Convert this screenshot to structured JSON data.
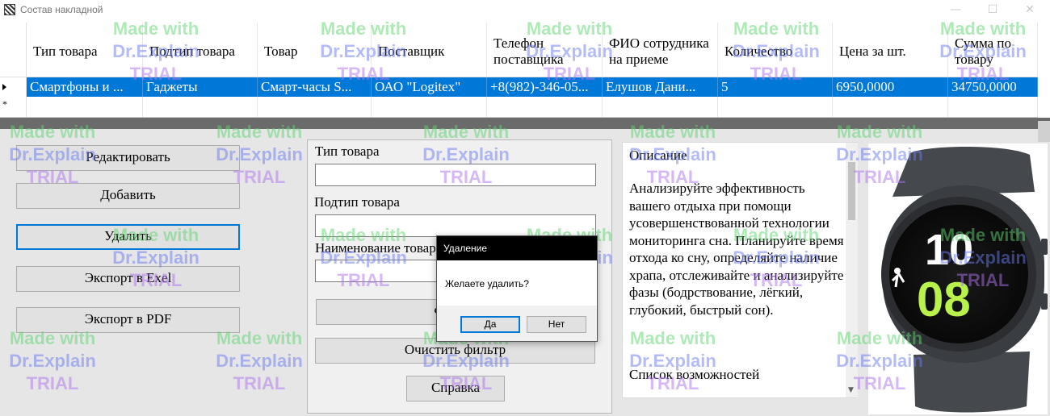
{
  "window": {
    "title": "Состав накладной",
    "minimize": "—",
    "maximize": "☐",
    "close": "✕"
  },
  "grid": {
    "columns": [
      "Тип товара",
      "Подтип товара",
      "Товар",
      "Поставщик",
      "Телефон поставщика",
      "ФИО сотрудника на приеме",
      "Количество",
      "Цена за шт.",
      "Сумма по товару"
    ],
    "selected_row": [
      "Смартфоны и ...",
      "Гаджеты",
      "Смарт-часы S...",
      "ОАО \"Logitex\"",
      "+8(982)-346-05...",
      "Елушов Дани...",
      "5",
      "6950,0000",
      "34750,0000"
    ],
    "new_row_marker": "*"
  },
  "actions": {
    "edit": "Редактировать",
    "add": "Добавить",
    "delete": "Удалить",
    "export_excel": "Экспорт в Exel",
    "export_pdf": "Экспорт в PDF"
  },
  "filter": {
    "type_label": "Тип товара",
    "type_value": "",
    "subtype_label": "Подтип товара",
    "subtype_value": "",
    "name_label": "Наименование товара",
    "name_value": "",
    "apply_button": "Фильтр",
    "clear_button": "Очистить фильтр",
    "help_button": "Справка"
  },
  "description": {
    "title": "Описание",
    "text": "Анализируйте эффективность вашего отдыха при помощи усовершенствованной технологии мониторинга сна. Планируйте время отхода ко сну, определяйте наличие храпа, отслеживайте и анализируйте фазы (бодрствование, лёгкий, глубокий, быстрый сон).",
    "features_title": "Список возможностей"
  },
  "product_image": {
    "hour": "10",
    "minute": "08",
    "colors": {
      "case": "#3a3d42",
      "band": "#45484d",
      "minute_digits": "#b9f24a"
    }
  },
  "dialog": {
    "title": "Удаление",
    "message": "Желаете удалить?",
    "yes": "Да",
    "no": "Нет"
  },
  "watermark": {
    "line1": "Made with",
    "line2": "Dr.Explain",
    "line3": "TRIAL"
  }
}
